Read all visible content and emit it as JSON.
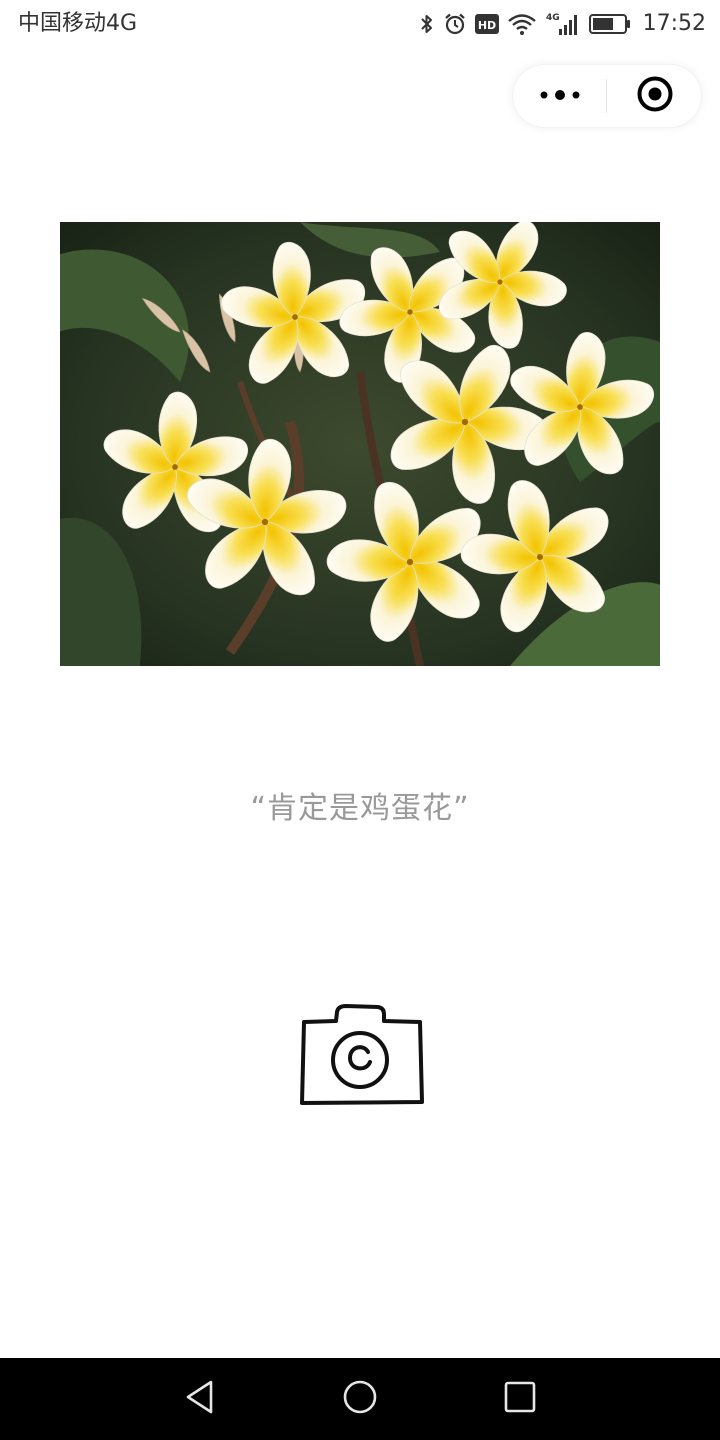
{
  "status_bar": {
    "carrier": "中国移动4G",
    "time": "17:52",
    "icons": [
      "bluetooth-icon",
      "alarm-icon",
      "hd-icon",
      "wifi-icon",
      "signal-4g-icon",
      "battery-icon"
    ],
    "hd_label": "HD",
    "network_label": "4G"
  },
  "capsule": {
    "more_icon": "more-dots-icon",
    "close_icon": "target-close-icon"
  },
  "main": {
    "photo_subject": "flower-photo",
    "caption": "“肯定是鸡蛋花”",
    "camera_icon": "camera-icon"
  },
  "nav_bar": {
    "icons": [
      "back-triangle-icon",
      "home-circle-icon",
      "recent-square-icon"
    ]
  },
  "colors": {
    "background": "#ffffff",
    "caption_text": "#999999",
    "nav_bar": "#000000",
    "status_text": "#333333"
  }
}
